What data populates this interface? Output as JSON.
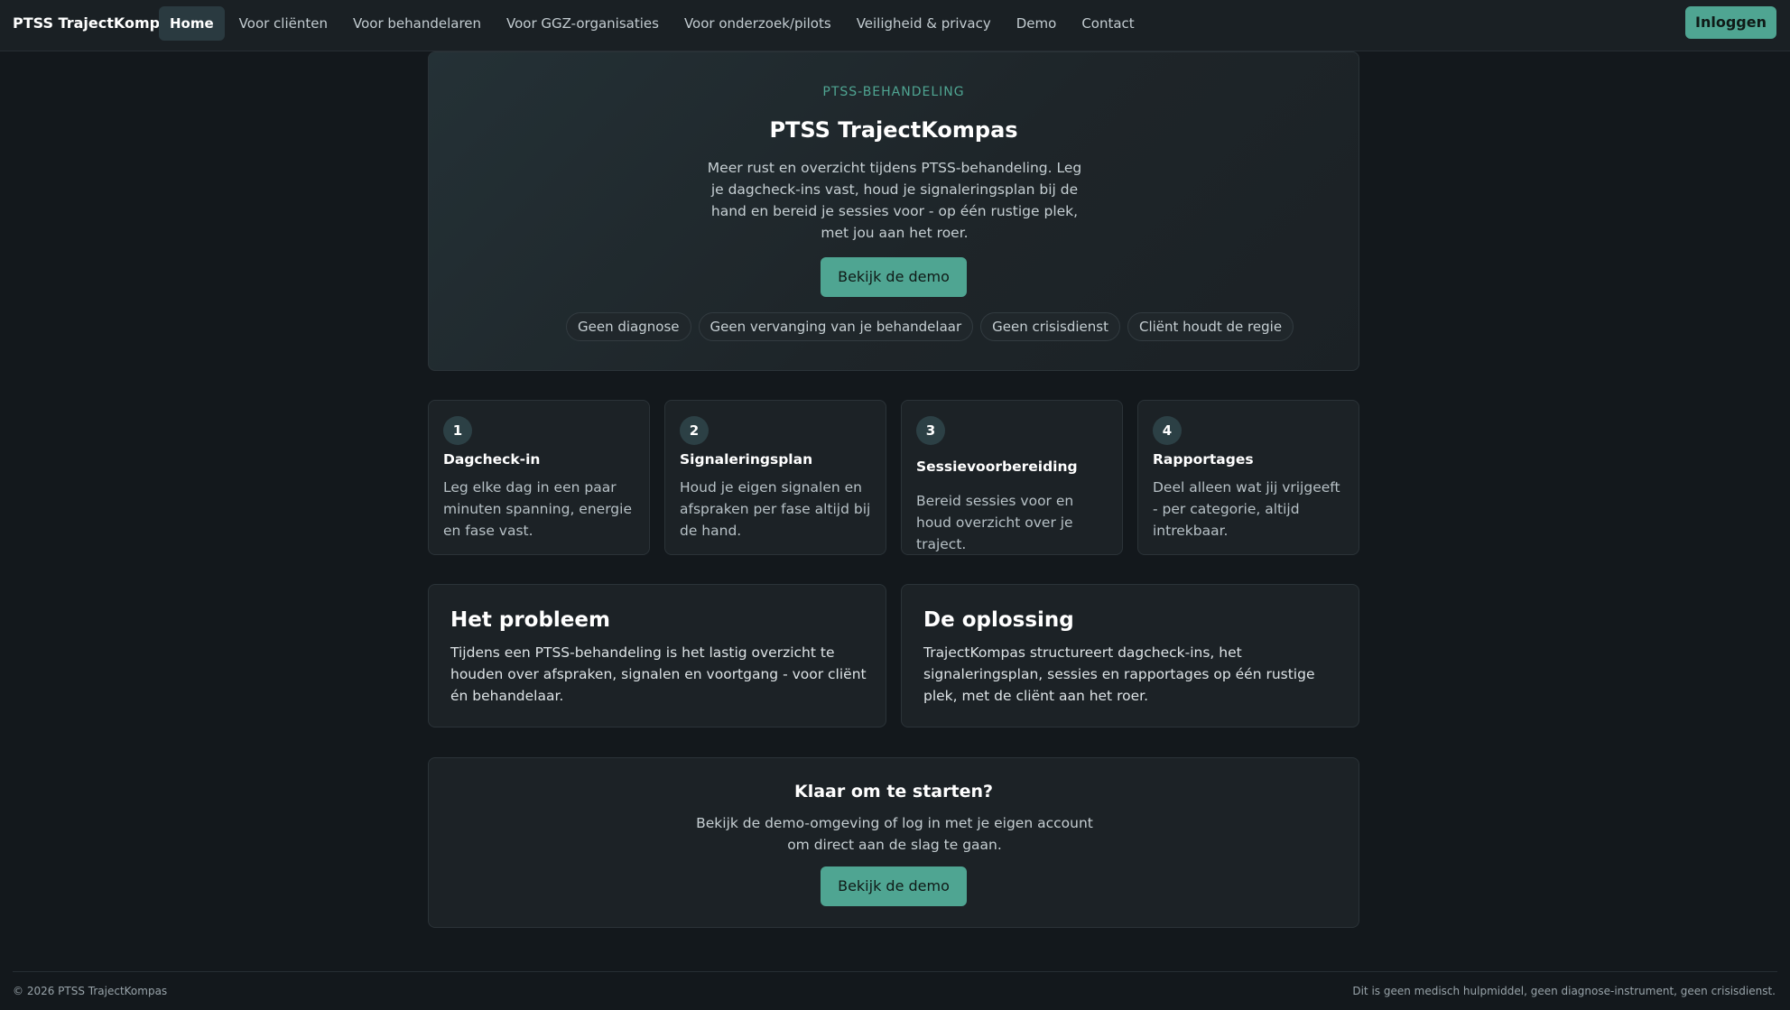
{
  "nav": {
    "brand": "PTSS TrajectKompas",
    "links": [
      "Home",
      "Voor cliënten",
      "Voor behandelaren",
      "Voor GGZ-organisaties",
      "Voor onderzoek/pilots",
      "Veiligheid & privacy",
      "Demo",
      "Contact"
    ],
    "active": "Home",
    "login": "Inloggen"
  },
  "hero": {
    "eyebrow": "PTSS-BEHANDELING",
    "title": "PTSS TrajectKompas",
    "text": "Meer rust en overzicht tijdens PTSS-behandeling. Leg je dagcheck-ins vast, houd je signaleringsplan bij de hand en bereid je sessies voor - op één rustige plek, met jou aan het roer.",
    "button": "Bekijk de demo",
    "pills": [
      "Geen diagnose",
      "Geen vervanging van je behandelaar",
      "Geen crisisdienst",
      "Cliënt houdt de regie"
    ]
  },
  "steps": [
    {
      "num": "1",
      "title": "Dagcheck-in",
      "text": "Leg elke dag in een paar minuten spanning, energie en fase vast."
    },
    {
      "num": "2",
      "title": "Signaleringsplan",
      "text": "Houd je eigen signalen en afspraken per fase altijd bij de hand."
    },
    {
      "num": "3",
      "title": "Sessievoorbereiding",
      "text": "Bereid sessies voor en houd overzicht over je traject."
    },
    {
      "num": "4",
      "title": "Rapportages",
      "text": "Deel alleen wat jij vrijgeeft - per categorie, altijd intrekbaar."
    }
  ],
  "problem": {
    "title": "Het probleem",
    "text": "Tijdens een PTSS-behandeling is het lastig overzicht te houden over afspraken, signalen en voortgang - voor cliënt én behandelaar."
  },
  "solution": {
    "title": "De oplossing",
    "text": "TrajectKompas structureert dagcheck-ins, het signaleringsplan, sessies en rapportages op één rustige plek, met de cliënt aan het roer."
  },
  "cta": {
    "title": "Klaar om te starten?",
    "text": "Bekijk de demo-omgeving of log in met je eigen account om direct aan de slag te gaan.",
    "button": "Bekijk de demo"
  },
  "footer": {
    "copyright": "© 2026 PTSS TrajectKompas",
    "disclaimer": "Dit is geen medisch hulpmiddel, geen diagnose-instrument, geen crisisdienst."
  },
  "colors": {
    "accent": "#4fa592",
    "background": "#13181c",
    "card": "#1c2226"
  }
}
